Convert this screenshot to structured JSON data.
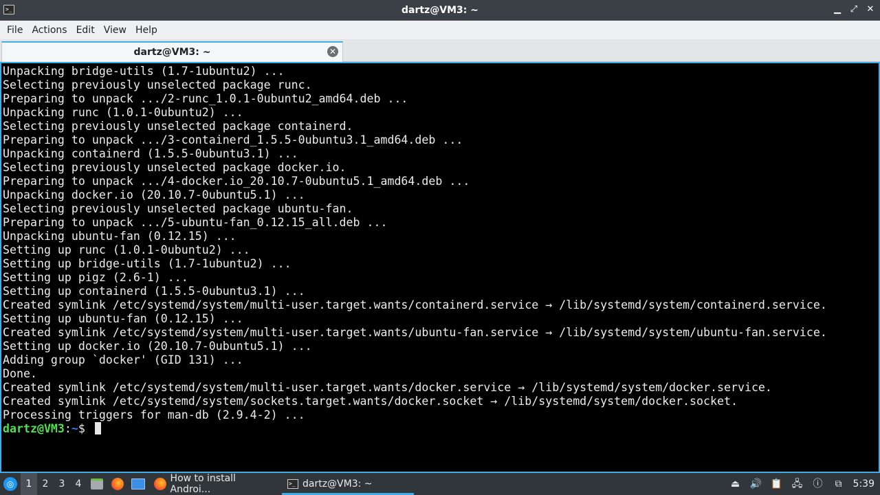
{
  "window": {
    "title": "dartz@VM3: ~",
    "minimize_glyph": "▁",
    "maximize_glyph": "⤢",
    "close_glyph": "✕"
  },
  "menubar": {
    "items": [
      "File",
      "Actions",
      "Edit",
      "View",
      "Help"
    ]
  },
  "tabs": [
    {
      "label": "dartz@VM3: ~",
      "close_glyph": "✕"
    }
  ],
  "terminal": {
    "lines": [
      "Unpacking bridge-utils (1.7-1ubuntu2) ...",
      "Selecting previously unselected package runc.",
      "Preparing to unpack .../2-runc_1.0.1-0ubuntu2_amd64.deb ...",
      "Unpacking runc (1.0.1-0ubuntu2) ...",
      "Selecting previously unselected package containerd.",
      "Preparing to unpack .../3-containerd_1.5.5-0ubuntu3.1_amd64.deb ...",
      "Unpacking containerd (1.5.5-0ubuntu3.1) ...",
      "Selecting previously unselected package docker.io.",
      "Preparing to unpack .../4-docker.io_20.10.7-0ubuntu5.1_amd64.deb ...",
      "Unpacking docker.io (20.10.7-0ubuntu5.1) ...",
      "Selecting previously unselected package ubuntu-fan.",
      "Preparing to unpack .../5-ubuntu-fan_0.12.15_all.deb ...",
      "Unpacking ubuntu-fan (0.12.15) ...",
      "Setting up runc (1.0.1-0ubuntu2) ...",
      "Setting up bridge-utils (1.7-1ubuntu2) ...",
      "Setting up pigz (2.6-1) ...",
      "Setting up containerd (1.5.5-0ubuntu3.1) ...",
      "Created symlink /etc/systemd/system/multi-user.target.wants/containerd.service → /lib/systemd/system/containerd.service.",
      "Setting up ubuntu-fan (0.12.15) ...",
      "Created symlink /etc/systemd/system/multi-user.target.wants/ubuntu-fan.service → /lib/systemd/system/ubuntu-fan.service.",
      "Setting up docker.io (20.10.7-0ubuntu5.1) ...",
      "Adding group `docker' (GID 131) ...",
      "Done.",
      "Created symlink /etc/systemd/system/multi-user.target.wants/docker.service → /lib/systemd/system/docker.service.",
      "Created symlink /etc/systemd/system/sockets.target.wants/docker.socket → /lib/systemd/system/docker.socket.",
      "Processing triggers for man-db (2.9.4-2) ..."
    ],
    "prompt": {
      "user_host": "dartz@VM3",
      "separator": ":",
      "path": "~",
      "symbol": "$ "
    }
  },
  "taskbar": {
    "desktops": [
      "1",
      "2",
      "3",
      "4"
    ],
    "active_desktop": "1",
    "tasks": [
      {
        "label": "How to install Androi...",
        "icon": "firefox-icon"
      },
      {
        "label": "dartz@VM3: ~",
        "icon": "terminal-icon"
      }
    ],
    "clock": "5:39"
  },
  "colors": {
    "accent": "#3daee9",
    "terminal_bg": "#000000",
    "prompt_user": "#4fe04f",
    "prompt_path": "#3b78ff"
  }
}
